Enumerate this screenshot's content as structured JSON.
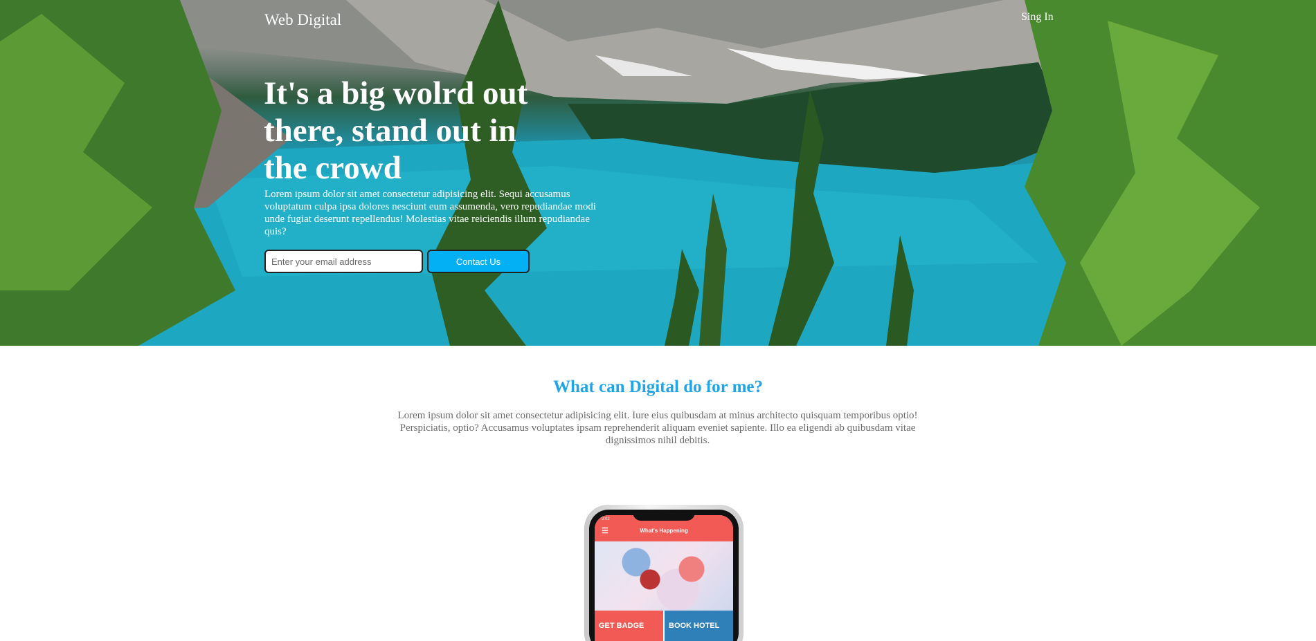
{
  "header": {
    "brand": "Web Digital",
    "signin_label": "Sing In"
  },
  "hero": {
    "headline": "It's a big wolrd out there, stand out in the crowd",
    "lede": "Lorem ipsum dolor sit amet consectetur adipisicing elit. Sequi accusamus voluptatum culpa ipsa dolores nesciunt eum assumenda, vero repudiandae modi unde fugiat deserunt repellendus! Molestias vitae reiciendis illum repudiandae quis?",
    "email_placeholder": "Enter your email address",
    "email_value": "",
    "contact_label": "Contact Us"
  },
  "feature": {
    "title": "What can Digital do for me?",
    "description": "Lorem ipsum dolor sit amet consectetur adipisicing elit. Iure eius quibusdam at minus architecto quisquam temporibus optio! Perspiciatis, optio? Accusamus voluptates ipsam reprehenderit aliquam eveniet sapiente. Illo ea eligendi ab quibusdam vitae dignissimos nihil debitis."
  },
  "phone_app": {
    "status_time": "9:02",
    "title": "What's Happening",
    "menu_icon": "hamburger-icon",
    "tiles": [
      {
        "label": "GET BADGE"
      },
      {
        "label": "BOOK HOTEL"
      }
    ]
  },
  "colors": {
    "accent": "#04b0f4",
    "feature_title": "#20a6e8",
    "app_red": "#f25a55",
    "app_blue": "#2f7fb8"
  }
}
